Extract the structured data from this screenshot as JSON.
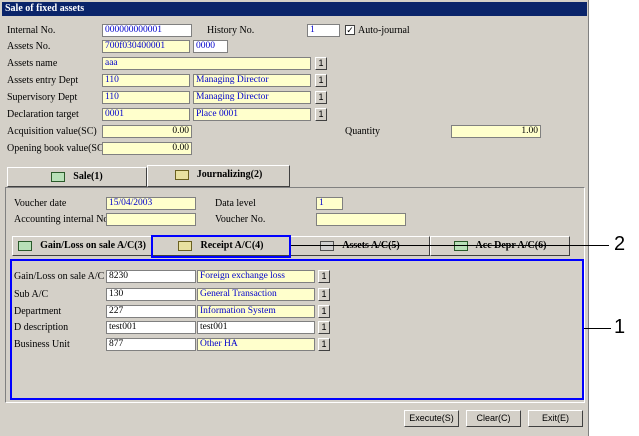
{
  "window": {
    "title": "Sale of fixed assets"
  },
  "header": {
    "internal_no_label": "Internal No.",
    "internal_no_value": "000000000001",
    "history_no_label": "History No.",
    "history_no_value": "1",
    "auto_journal_label": "Auto-journal",
    "auto_journal_checked": "✓",
    "assets_no_label": "Assets No.",
    "assets_no_value": "700f030400001",
    "assets_no_sub": "0000",
    "assets_name_label": "Assets name",
    "assets_name_value": "aaa",
    "entry_dept_label": "Assets entry Dept",
    "entry_dept_code": "110",
    "entry_dept_name": "Managing Director",
    "sup_dept_label": "Supervisory Dept",
    "sup_dept_code": "110",
    "sup_dept_name": "Managing Director",
    "decl_label": "Declaration target",
    "decl_code": "0001",
    "decl_name": "Place 0001",
    "acq_label": "Acquisition value(SC)",
    "acq_value": "0.00",
    "quantity_label": "Quantity",
    "quantity_value": "1.00",
    "opening_label": "Opening book value(SC)",
    "opening_value": "0.00",
    "lookup_btn": "1"
  },
  "tabs": [
    {
      "label": "Sale(1)"
    },
    {
      "label": "Journalizing(2)"
    }
  ],
  "journal": {
    "voucher_date_label": "Voucher date",
    "voucher_date_value": "15/04/2003",
    "data_level_label": "Data level",
    "data_level_value": "1",
    "acct_internal_label": "Accounting internal No.",
    "acct_internal_value": "",
    "voucher_no_label": "Voucher No.",
    "voucher_no_value": ""
  },
  "subtabs": [
    {
      "label": "Gain/Loss on sale A/C(3)"
    },
    {
      "label": "Receipt A/C(4)"
    },
    {
      "label": "Assets A/C(5)"
    },
    {
      "label": "Acc Depr A/C(6)"
    }
  ],
  "account_rows": [
    {
      "label": "Gain/Loss on sale A/C",
      "code": "8230",
      "name": "Foreign exchange loss"
    },
    {
      "label": "Sub A/C",
      "code": "130",
      "name": "General Transaction"
    },
    {
      "label": "Department",
      "code": "227",
      "name": "Information System"
    },
    {
      "label": "D description",
      "code": "test001",
      "name": "test001"
    },
    {
      "label": "Business Unit",
      "code": "877",
      "name": "Other HA"
    }
  ],
  "buttons": {
    "execute": "Execute(S)",
    "clear": "Clear(C)",
    "exit": "Exit(E)"
  },
  "callouts": {
    "one": "1",
    "two": "2"
  }
}
